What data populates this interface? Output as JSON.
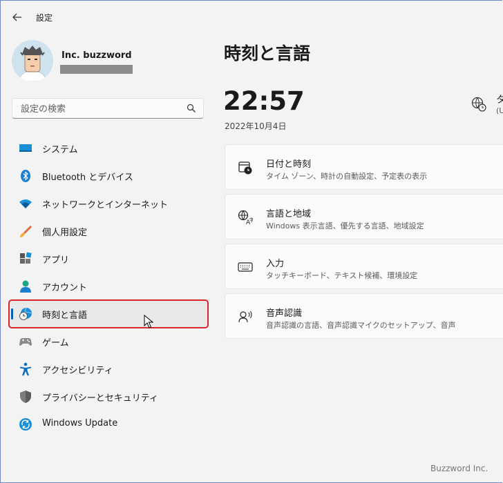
{
  "window": {
    "title": "設定"
  },
  "user": {
    "name": "Inc. buzzword"
  },
  "search": {
    "placeholder": "設定の検索"
  },
  "sidebar": {
    "items": [
      {
        "label": "システム",
        "icon": "system-icon"
      },
      {
        "label": "Bluetooth とデバイス",
        "icon": "bluetooth-icon"
      },
      {
        "label": "ネットワークとインターネット",
        "icon": "wifi-icon"
      },
      {
        "label": "個人用設定",
        "icon": "brush-icon"
      },
      {
        "label": "アプリ",
        "icon": "apps-icon"
      },
      {
        "label": "アカウント",
        "icon": "account-icon"
      },
      {
        "label": "時刻と言語",
        "icon": "time-language-icon",
        "selected": true
      },
      {
        "label": "ゲーム",
        "icon": "gamepad-icon"
      },
      {
        "label": "アクセシビリティ",
        "icon": "accessibility-icon"
      },
      {
        "label": "プライバシーとセキュリティ",
        "icon": "shield-icon"
      },
      {
        "label": "Windows Update",
        "icon": "update-icon"
      }
    ]
  },
  "main": {
    "heading": "時刻と言語",
    "time": "22:57",
    "date": "2022年10月4日",
    "timezone": {
      "line1": "タ",
      "line2": "(U"
    },
    "cards": [
      {
        "title": "日付と時刻",
        "subtitle": "タイム ゾーン、時計の自動設定、予定表の表示",
        "icon": "calendar-clock-icon"
      },
      {
        "title": "言語と地域",
        "subtitle": "Windows 表示言語、優先する言語、地域設定",
        "icon": "language-icon"
      },
      {
        "title": "入力",
        "subtitle": "タッチキーボード、テキスト候補、環境設定",
        "icon": "keyboard-icon"
      },
      {
        "title": "音声認識",
        "subtitle": "音声認識の言語、音声認識マイクのセットアップ、音声",
        "icon": "speech-icon"
      }
    ]
  },
  "watermark": "Buzzword Inc.",
  "colors": {
    "accent": "#0063b1",
    "highlight": "#d9232d",
    "background": "#f3f3f3"
  }
}
